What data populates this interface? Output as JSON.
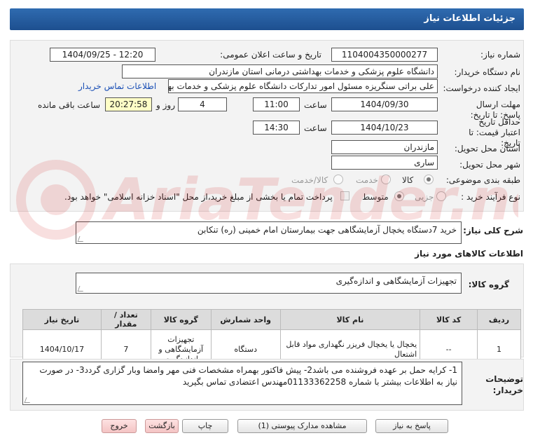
{
  "header": {
    "title": "جزئیات اطلاعات نیاز"
  },
  "labels": {
    "need_number": "شماره نیاز:",
    "announce_datetime": "تاریخ و ساعت اعلان عمومی:",
    "buyer_org": "نام دستگاه خریدار:",
    "requester": "ایجاد کننده درخواست:",
    "response_deadline": "مهلت ارسال پاسخ: تا تاریخ:",
    "hour": "ساعت",
    "day_and": "روز و",
    "time_remaining": "ساعت باقی مانده",
    "price_validity": "حداقل تاریخ اعتبار قیمت: تا تاریخ:",
    "delivery_province": "استان محل تحویل:",
    "delivery_city": "شهر محل تحویل:",
    "category": "طبقه بندی موضوعی:",
    "purchase_process": "نوع فرآیند خرید :",
    "description": "شرح کلی نیاز:",
    "goods_info": "اطلاعات کالاهای مورد نیاز",
    "goods_group": "گروه کالا:",
    "buyer_notes": "توضیحات خریدار:"
  },
  "fields": {
    "need_number": "1104004350000277",
    "announce_datetime": "1404/09/25 - 12:20",
    "buyer_org": "دانشگاه علوم پزشکی و خدمات بهداشتی  درمانی استان مازندران",
    "requester": "علی براتی سنگریزه مسئول امور تدارکات دانشگاه علوم پزشکی و خدمات بهداشتی",
    "contact_link": "اطلاعات تماس خریدار",
    "response_date": "1404/09/30",
    "response_hour": "11:00",
    "response_days": "4",
    "remaining_time": "20:27:58",
    "validity_date": "1404/10/23",
    "validity_hour": "14:30",
    "province": "مازندران",
    "city": "ساری",
    "description": "خرید 7دستگاه یخچال آزمایشگاهی جهت بیمارستان امام خمینی (ره) تنکابن",
    "goods_group": "تجهیزات آزمایشگاهی و اندازه‌گیری",
    "notes": "1- کرایه حمل بر عهده فروشنده می باشد2- پیش فاکتور بهمراه مشخصات فنی مهر وامضا وبار گزاری گردد3- در صورت نیاز به اطلاعات بیشتر با شماره 01133362258مهندس اعتضادی تماس بگیرید"
  },
  "category_options": [
    {
      "label": "کالا",
      "selected": true
    },
    {
      "label": "خدمت",
      "selected": false
    },
    {
      "label": "کالا/خدمت",
      "selected": false
    }
  ],
  "process_options": [
    {
      "label": "جزیی",
      "selected": false
    },
    {
      "label": "متوسط",
      "selected": true
    }
  ],
  "payment_note": "پرداخت تمام یا بخشی از مبلغ خرید،از محل \"اسناد خزانه اسلامی\" خواهد بود.",
  "table": {
    "headers": [
      "ردیف",
      "کد کالا",
      "نام کالا",
      "واحد شمارش",
      "تعداد / مقدار",
      "تاریخ نیاز"
    ],
    "rows": [
      [
        "1",
        "--",
        "یخچال یا یخچال فریزر نگهداری مواد قابل اشتعال",
        "دستگاه",
        "7",
        "1404/10/17"
      ]
    ],
    "group_column_header": "گروه کالا",
    "group_column_value": "تجهیزات آزمایشگاهی و اندازه‌گیری"
  },
  "buttons": {
    "reply": "پاسخ به نیاز",
    "documents": "مشاهده مدارک پیوستی (1)",
    "print": "چاپ",
    "back": "بازگشت",
    "exit": "خروج"
  },
  "watermark_text": "AriaTender.neT"
}
